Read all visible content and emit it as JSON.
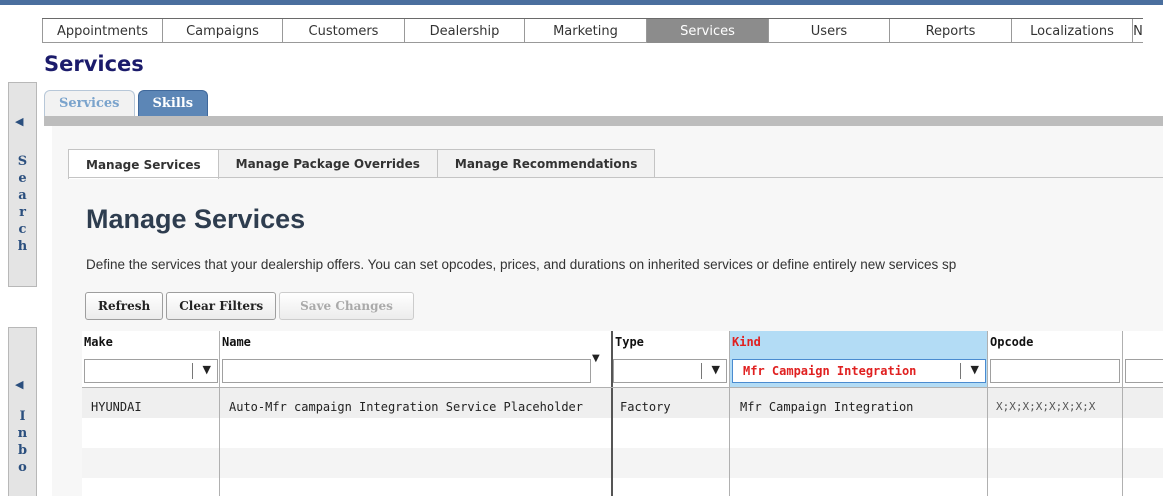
{
  "nav": {
    "items": [
      {
        "label": "Appointments",
        "active": false
      },
      {
        "label": "Campaigns",
        "active": false
      },
      {
        "label": "Customers",
        "active": false
      },
      {
        "label": "Dealership",
        "active": false
      },
      {
        "label": "Marketing",
        "active": false
      },
      {
        "label": "Services",
        "active": true
      },
      {
        "label": "Users",
        "active": false
      },
      {
        "label": "Reports",
        "active": false
      },
      {
        "label": "Localizations",
        "active": false
      },
      {
        "label": "N",
        "active": false
      }
    ]
  },
  "page": {
    "title": "Services"
  },
  "side": {
    "search_letters": [
      "S",
      "e",
      "a",
      "r",
      "c",
      "h"
    ],
    "inbox_letters": [
      "I",
      "n",
      "b",
      "o"
    ],
    "arrow": "◀"
  },
  "subtabs": [
    {
      "label": "Services",
      "active": false
    },
    {
      "label": "Skills",
      "active": true
    }
  ],
  "manage_tabs": [
    {
      "label": "Manage Services",
      "active": true
    },
    {
      "label": "Manage Package Overrides",
      "active": false
    },
    {
      "label": "Manage Recommendations",
      "active": false
    }
  ],
  "section": {
    "title": "Manage Services",
    "description": "Define the services that your dealership offers. You can set opcodes, prices, and durations on inherited services or define entirely new services sp"
  },
  "toolbar": {
    "refresh_label": "Refresh",
    "clear_filters_label": "Clear Filters",
    "save_changes_label": "Save Changes"
  },
  "grid": {
    "columns": [
      "Make",
      "Name",
      "Type",
      "Kind",
      "Opcode"
    ],
    "filters": {
      "make": "",
      "name": "",
      "type": "",
      "kind": "Mfr Campaign Integration",
      "opcode": ""
    },
    "rows": [
      {
        "make": "HYUNDAI",
        "name": "Auto-Mfr campaign Integration Service Placeholder",
        "type": "Factory",
        "kind": "Mfr Campaign Integration",
        "opcode": "X;X;X;X;X;X;X;X"
      }
    ]
  },
  "icons": {
    "dropdown": "caret-down-icon",
    "collapse": "arrow-left-icon"
  },
  "colors": {
    "accent": "#4a6f9e",
    "active_tab": "#5c86b6",
    "kind_highlight": "#b3dcf5",
    "kind_text": "#e02020",
    "title": "#1b1b6b"
  }
}
